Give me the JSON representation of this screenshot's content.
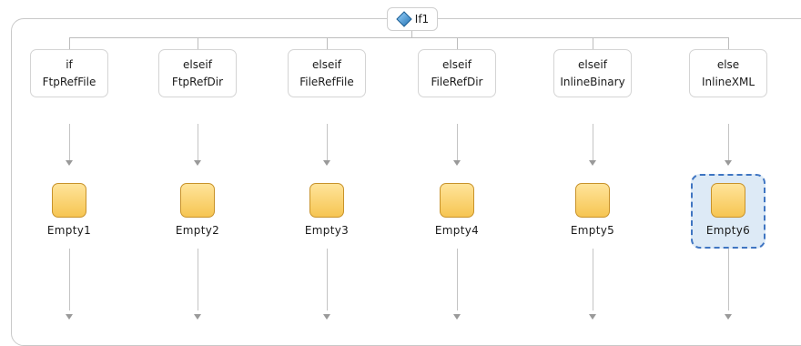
{
  "if_activity": {
    "title": "If1",
    "icon": "diamond-icon"
  },
  "branches": [
    {
      "keyword": "if",
      "condition": "FtpRefFile",
      "activity": "Empty1",
      "selected": false
    },
    {
      "keyword": "elseif",
      "condition": "FtpRefDir",
      "activity": "Empty2",
      "selected": false
    },
    {
      "keyword": "elseif",
      "condition": "FileRefFile",
      "activity": "Empty3",
      "selected": false
    },
    {
      "keyword": "elseif",
      "condition": "FileRefDir",
      "activity": "Empty4",
      "selected": false
    },
    {
      "keyword": "elseif",
      "condition": "InlineBinary",
      "activity": "Empty5",
      "selected": false
    },
    {
      "keyword": "else",
      "condition": "InlineXML",
      "activity": "Empty6",
      "selected": true
    }
  ],
  "colors": {
    "selection_border": "#3f75c2",
    "selection_fill": "#ddeaf6",
    "activity_icon": "#f6c552",
    "diamond_icon": "#2f8fd0"
  }
}
